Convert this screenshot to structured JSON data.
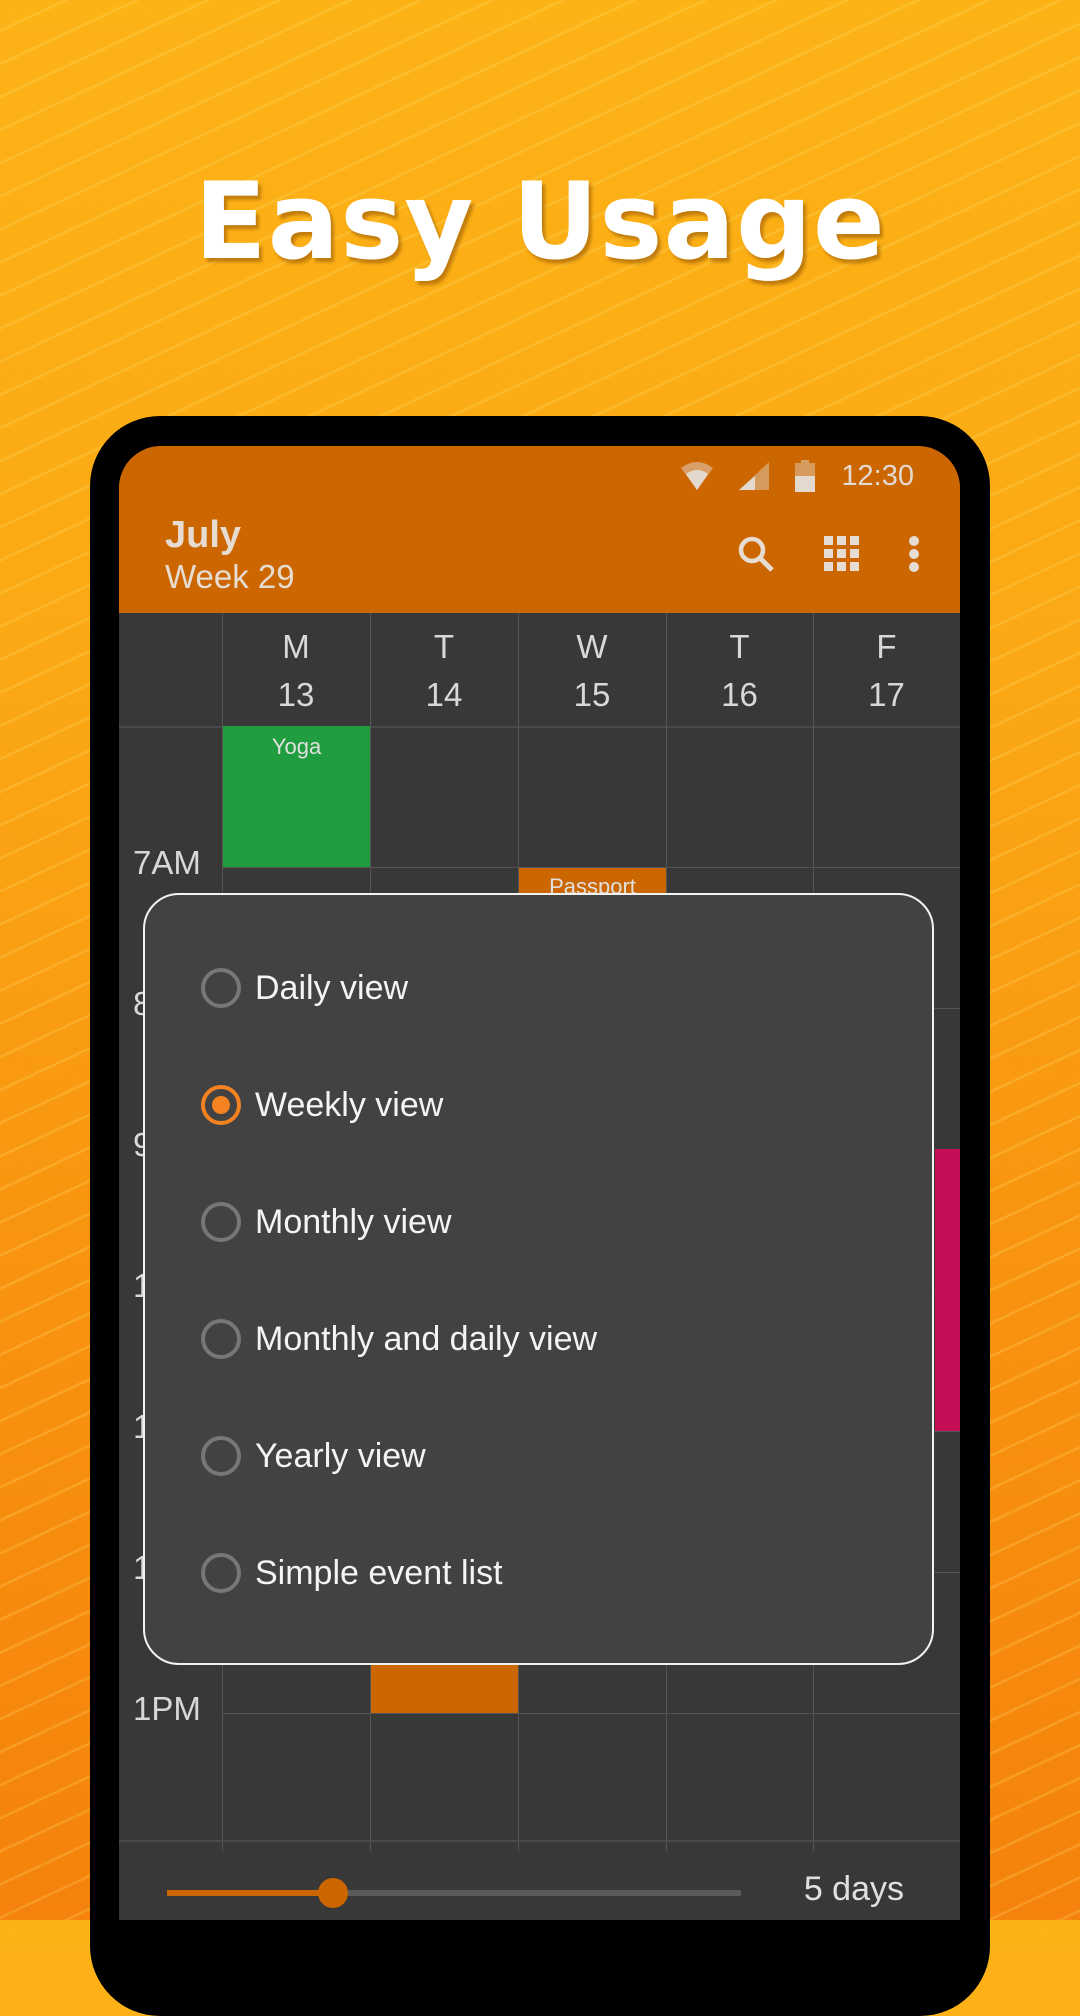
{
  "headline": "Easy Usage",
  "status_bar": {
    "time": "12:30",
    "icons": [
      "wifi-icon",
      "signal-icon",
      "battery-icon"
    ]
  },
  "app_bar": {
    "title": "July",
    "subtitle": "Week 29",
    "actions": [
      "search-icon",
      "grid-icon",
      "more-vert-icon"
    ]
  },
  "days": [
    {
      "letter": "M",
      "date": "13"
    },
    {
      "letter": "T",
      "date": "14"
    },
    {
      "letter": "W",
      "date": "15"
    },
    {
      "letter": "T",
      "date": "16"
    },
    {
      "letter": "F",
      "date": "17"
    }
  ],
  "time_labels": [
    "7AM",
    "8",
    "9",
    "1",
    "1",
    "1",
    "1PM"
  ],
  "events": [
    {
      "title": "Yoga",
      "color": "#209e3f"
    },
    {
      "title": "Passport",
      "color": "#cc6600"
    },
    {
      "title": "",
      "color": "#c60d58"
    },
    {
      "title": "",
      "color": "#cc6600"
    }
  ],
  "dialog": {
    "options": [
      {
        "label": "Daily view",
        "selected": false
      },
      {
        "label": "Weekly view",
        "selected": true
      },
      {
        "label": "Monthly view",
        "selected": false
      },
      {
        "label": "Monthly and daily view",
        "selected": false
      },
      {
        "label": "Yearly view",
        "selected": false
      },
      {
        "label": "Simple event list",
        "selected": false
      }
    ]
  },
  "slider": {
    "label": "5 days",
    "value_fraction": 0.29
  },
  "colors": {
    "accent": "#cc6600",
    "radio_selected": "#f58220"
  }
}
